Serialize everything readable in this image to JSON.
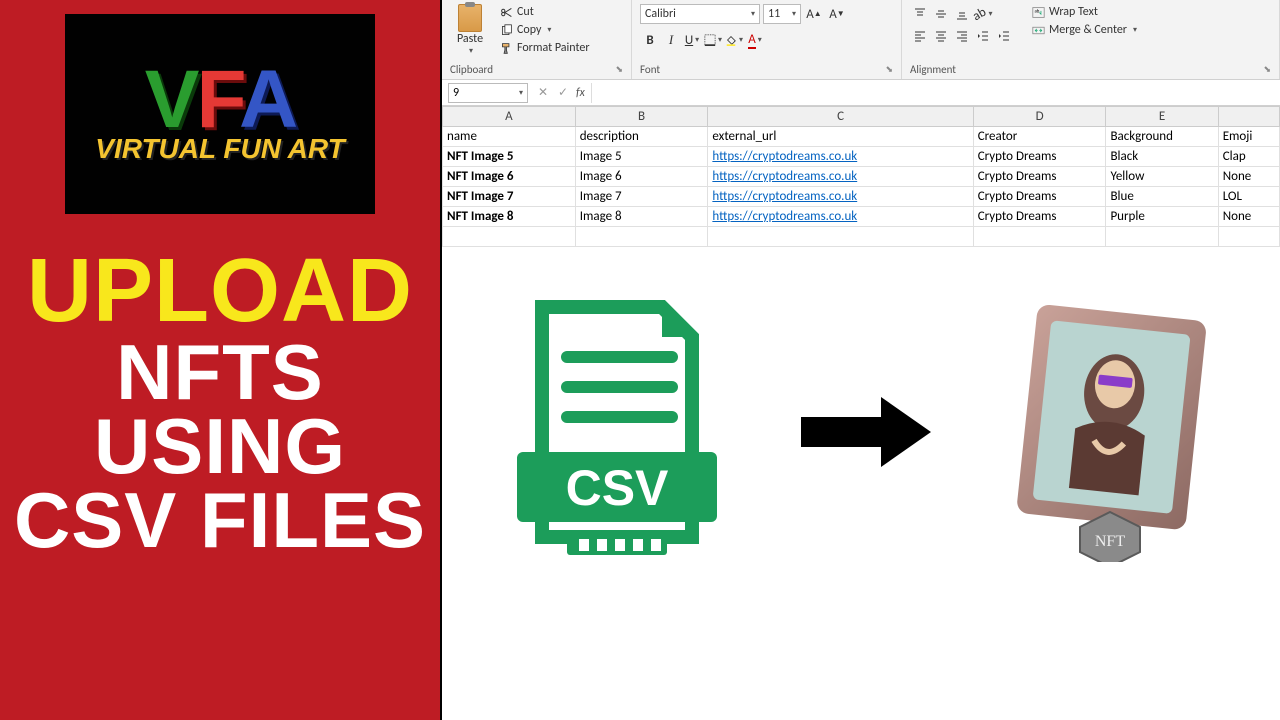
{
  "left": {
    "logo": {
      "v": "V",
      "f": "F",
      "a": "A",
      "subtitle": "VIRTUAL FUN ART"
    },
    "title": {
      "l1": "UPLOAD",
      "l2": "NFTS",
      "l3": "USING",
      "l4": "CSV FILES"
    }
  },
  "ribbon": {
    "clipboard": {
      "paste": "Paste",
      "cut": "Cut",
      "copy": "Copy",
      "format_painter": "Format Painter",
      "label": "Clipboard"
    },
    "font": {
      "name": "Calibri",
      "size": "11",
      "label": "Font"
    },
    "alignment": {
      "wrap": "Wrap Text",
      "merge": "Merge & Center",
      "label": "Alignment"
    }
  },
  "formula_bar": {
    "name_box": "9",
    "fx": "fx"
  },
  "sheet": {
    "columns": [
      "A",
      "B",
      "C",
      "D",
      "E",
      ""
    ],
    "headers": [
      "name",
      "description",
      "external_url",
      "Creator",
      "Background",
      "Emoji"
    ],
    "rows": [
      {
        "name": "NFT Image 5",
        "desc": "Image 5",
        "url": "https://cryptodreams.co.uk",
        "creator": "Crypto Dreams",
        "bg": "Black",
        "emoji": "Clap"
      },
      {
        "name": "NFT Image 6",
        "desc": "Image 6",
        "url": "https://cryptodreams.co.uk",
        "creator": "Crypto Dreams",
        "bg": "Yellow",
        "emoji": "None"
      },
      {
        "name": "NFT Image 7",
        "desc": "Image 7",
        "url": "https://cryptodreams.co.uk",
        "creator": "Crypto Dreams",
        "bg": "Blue",
        "emoji": "LOL"
      },
      {
        "name": "NFT Image 8",
        "desc": "Image 8",
        "url": "https://cryptodreams.co.uk",
        "creator": "Crypto Dreams",
        "bg": "Purple",
        "emoji": "None"
      }
    ]
  },
  "illustration": {
    "csv_label": "CSV",
    "nft_label": "NFT"
  }
}
